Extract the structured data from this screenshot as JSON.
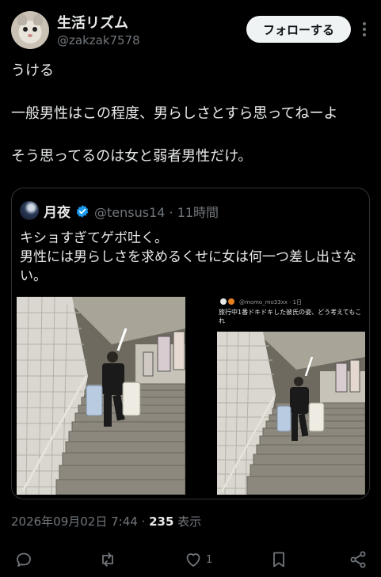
{
  "author": {
    "display_name": "生活リズム",
    "handle": "@zakzak7578"
  },
  "follow_label": "フォローする",
  "tweet": {
    "lines": [
      "うける",
      "一般男性はこの程度、男らしさとすら思ってねーよ",
      "そう思ってるのは女と弱者男性だけ。"
    ]
  },
  "quote": {
    "display_name": "月夜",
    "handle_time": "@tensus14 · 11時間",
    "text": "キショすぎてゲボ吐く。\n男性には男らしさを求めるくせに女は何一つ差し出さない。",
    "embedded_post": {
      "handle_time": "@momo_mo33xx · 1日",
      "text": "旅行中1番ドキドキした彼氏の姿、どう考えてもこれ"
    }
  },
  "meta": {
    "timestamp": "2026年09月02日 7:44",
    "separator": " · ",
    "views_count": "235",
    "views_label": " 表示"
  },
  "actions": {
    "like_count": "1"
  },
  "colors": {
    "background": "#000000",
    "text": "#e7e9ea",
    "muted": "#71767b",
    "border": "#2f3336",
    "verified": "#1d9bf0"
  }
}
